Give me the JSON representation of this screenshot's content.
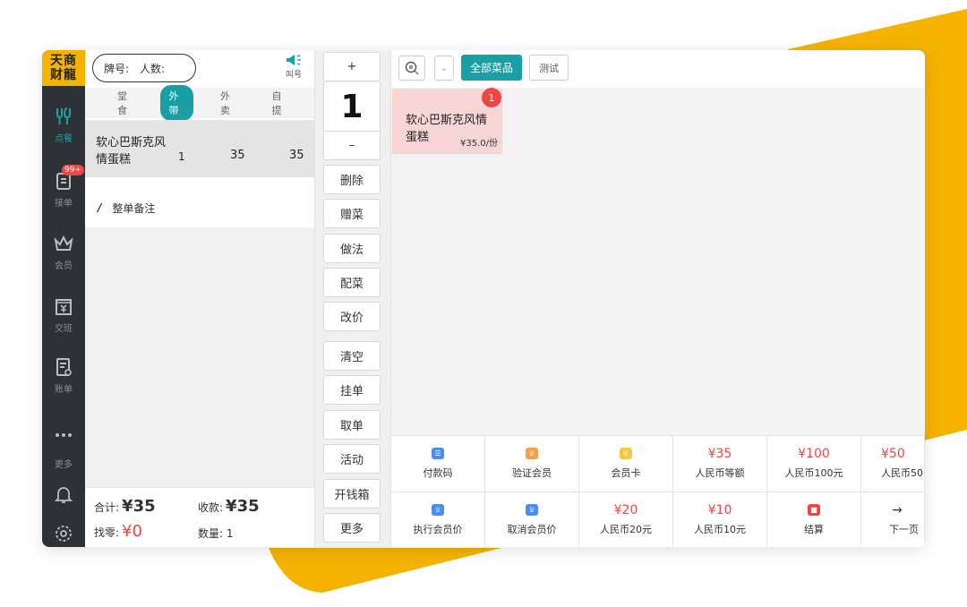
{
  "logo": {
    "line1": "天商",
    "line2": "财龍"
  },
  "nav": [
    {
      "label": "点餐",
      "icon": "utensils-icon",
      "active": true
    },
    {
      "label": "接单",
      "icon": "clipboard-icon",
      "badge": "99+"
    },
    {
      "label": "会员",
      "icon": "crown-icon"
    },
    {
      "label": "交班",
      "icon": "cashbox-icon"
    },
    {
      "label": "账单",
      "icon": "bill-icon"
    },
    {
      "label": "更多",
      "icon": "more-dots-icon"
    }
  ],
  "order": {
    "table_label": "牌号:",
    "people_label": "人数:",
    "call_label": "叫号",
    "modes": [
      "堂食",
      "外带",
      "外卖",
      "自提"
    ],
    "active_mode": "外带",
    "items": [
      {
        "name_line1": "软心巴斯克风",
        "name_line2": "情蛋糕",
        "qty": "1",
        "price": "35",
        "total": "35"
      }
    ],
    "note_label": "整单备注",
    "summary": {
      "total_label": "合计:",
      "total_value": "¥35",
      "received_label": "收款:",
      "received_value": "¥35",
      "change_label": "找零:",
      "change_value": "¥0",
      "count_label": "数量:",
      "count_value": "1"
    }
  },
  "actions": {
    "plus": "+",
    "quantity": "1",
    "minus": "–",
    "buttons": [
      "删除",
      "赠菜",
      "做法",
      "配菜",
      "改价",
      "清空",
      "挂单",
      "取单",
      "活动",
      "开钱箱",
      "更多"
    ]
  },
  "menu": {
    "categories": [
      "全部菜品",
      "测试"
    ],
    "dishes": [
      {
        "name": "软心巴斯克风情蛋糕",
        "price": "¥35.0/份",
        "count": "1"
      }
    ]
  },
  "payments": {
    "row1": [
      {
        "label": "付款码",
        "icon": "paycode-icon",
        "color": "#4a8ef0"
      },
      {
        "label": "验证会员",
        "icon": "crown-icon",
        "color": "#f5a04a"
      },
      {
        "label": "会员卡",
        "icon": "crown-icon",
        "color": "#f5c842"
      },
      {
        "amount": "¥35",
        "label": "人民币等额"
      },
      {
        "amount": "¥100",
        "label": "人民币100元"
      },
      {
        "amount": "¥50",
        "label": "人民币50"
      }
    ],
    "row2": [
      {
        "label": "执行会员价",
        "icon": "crown-icon",
        "color": "#4a8ef0"
      },
      {
        "label": "取消会员价",
        "icon": "crown-icon",
        "color": "#4a8ef0"
      },
      {
        "amount": "¥20",
        "label": "人民币20元"
      },
      {
        "amount": "¥10",
        "label": "人民币10元"
      },
      {
        "label": "结算",
        "icon": "wallet-icon",
        "color": "#f04545"
      },
      {
        "arrow": "→",
        "label": "下一页"
      }
    ]
  },
  "colors": {
    "accent": "#19a0a4",
    "brand_yellow": "#f5b300",
    "alert": "#f04545"
  }
}
